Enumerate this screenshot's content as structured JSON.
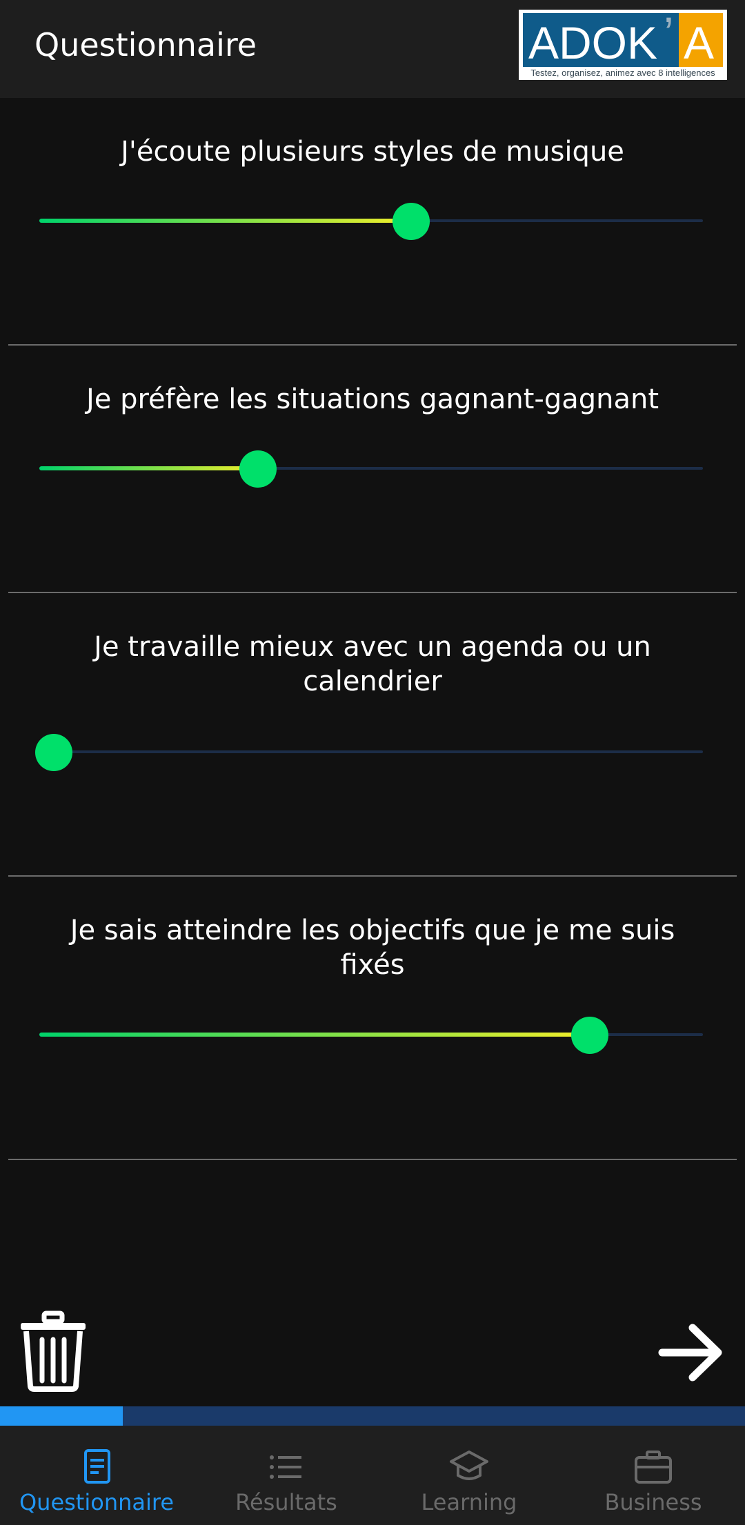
{
  "header": {
    "title": "Questionnaire",
    "logo": {
      "brand": "ADOK'A",
      "tagline": "Testez, organisez, animez avec 8 intelligences"
    }
  },
  "questions": [
    {
      "text": "J'écoute plusieurs styles de musique",
      "value_fraction": 0.56
    },
    {
      "text": "Je préfère les situations gagnant-gagnant",
      "value_fraction": 0.33
    },
    {
      "text": "Je travaille mieux avec un agenda ou un calendrier",
      "value_fraction": 0.0
    },
    {
      "text": "Je sais atteindre les objectifs que je me suis fixés",
      "value_fraction": 0.83
    }
  ],
  "actions": {
    "delete_icon": "trash-icon",
    "next_icon": "arrow-right-icon"
  },
  "progress": {
    "fraction": 0.165
  },
  "nav": {
    "items": [
      {
        "label": "Questionnaire",
        "icon": "document-icon",
        "active": true
      },
      {
        "label": "Résultats",
        "icon": "list-icon",
        "active": false
      },
      {
        "label": "Learning",
        "icon": "graduation-cap-icon",
        "active": false
      },
      {
        "label": "Business",
        "icon": "briefcase-icon",
        "active": false
      }
    ]
  },
  "colors": {
    "accent": "#2196f3",
    "slider_thumb": "#00e06a",
    "slider_gradient_start": "#00d36b",
    "slider_gradient_end": "#f2ee2a",
    "track": "#1c2d48"
  }
}
